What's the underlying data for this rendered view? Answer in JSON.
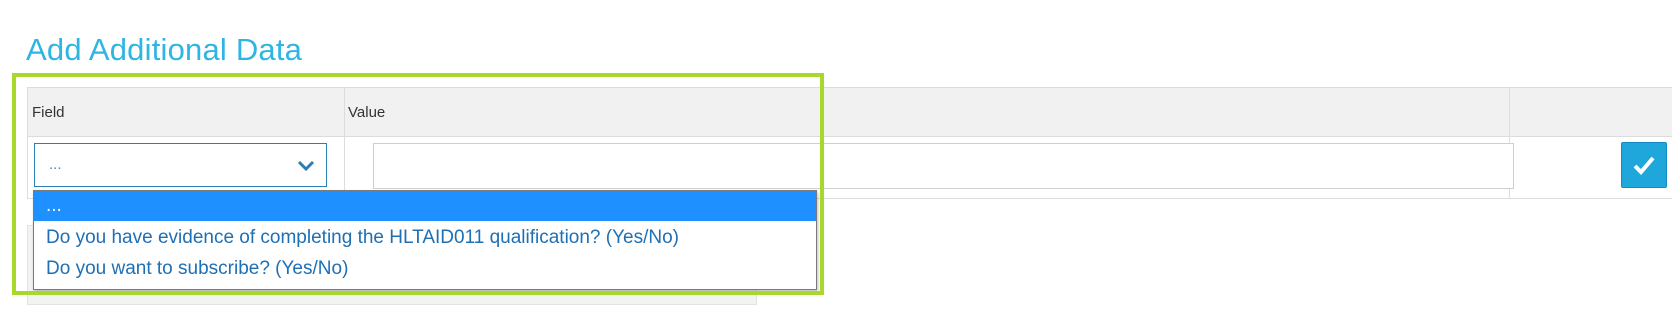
{
  "section_title": "Add Additional Data",
  "table": {
    "columns": [
      "Field",
      "Value"
    ]
  },
  "field_select": {
    "selected": "...",
    "options": [
      "...",
      "Do you have evidence of completing the HLTAID011 qualification? (Yes/No)",
      "Do you want to subscribe? (Yes/No)"
    ],
    "selected_index": 0
  },
  "value_input": {
    "value": "",
    "placeholder": ""
  },
  "confirm_button": {
    "icon": "checkmark-icon"
  },
  "colors": {
    "title": "#2fb5e3",
    "highlight": "#a8d82a",
    "selected_option": "#1e90ff",
    "confirm_button": "#1fa7dc"
  }
}
